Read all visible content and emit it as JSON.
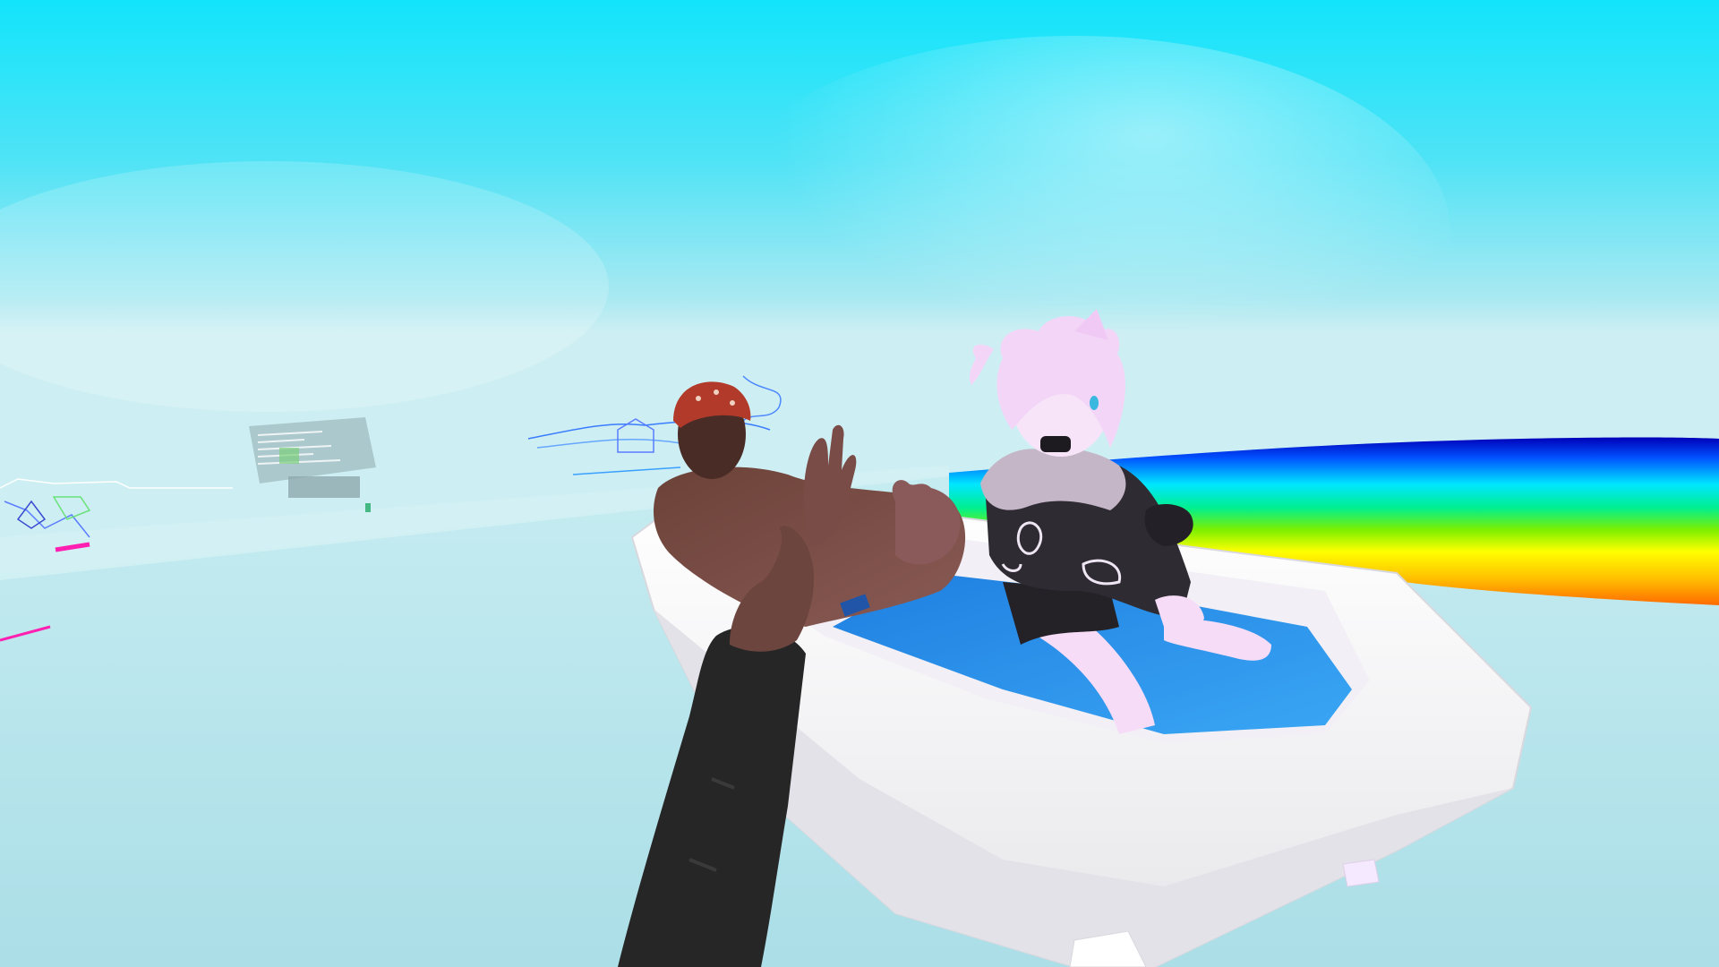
{
  "scene": {
    "sky_top_color": "#1ee8fb",
    "sky_mid_color": "#8fe6f4",
    "horizon_color": "#cdeff3",
    "floor_color": "#b3e2ea",
    "rainbow_colors": [
      "#0000b8",
      "#0060ff",
      "#00e8ff",
      "#00f08a",
      "#8cf000",
      "#ffff00",
      "#ffbf00",
      "#ff6a00"
    ],
    "tub_color": "#f4f4f4",
    "water_color": "#2d95f0"
  },
  "characters": {
    "bather_man": {
      "icon": "person-in-bandana-icon",
      "bandana_color": "#b23a2a"
    },
    "bather_catgirl": {
      "icon": "catgirl-avatar-icon",
      "hair_color": "#f3d6f7",
      "jacket_color": "#2f2b33"
    }
  },
  "first_person": {
    "icon": "player-arm-icon",
    "sleeve_color": "#262626"
  },
  "distant_objects": {
    "panel_icon": "floating-info-panel-icon",
    "sketch_icon": "3d-doodle-drawing-icon"
  }
}
